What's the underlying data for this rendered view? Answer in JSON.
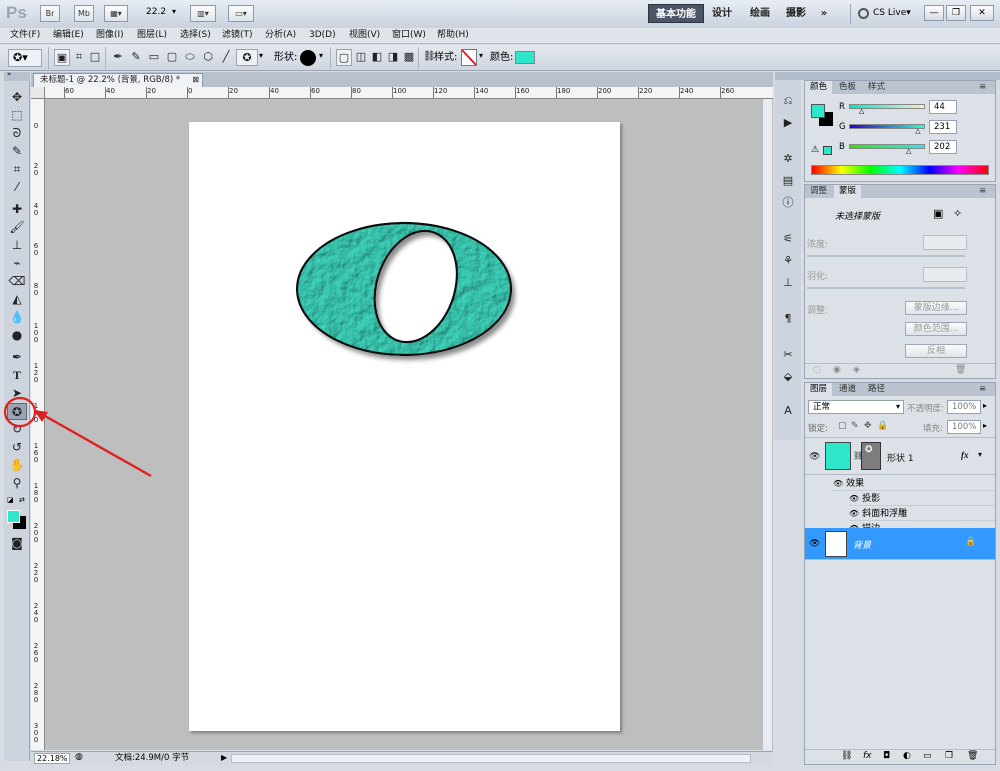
{
  "app": {
    "logo": "Ps",
    "bar_buttons": [
      "Br",
      "Mb"
    ],
    "zoom_value": "22.2",
    "workspaces": [
      "基本功能",
      "设计",
      "绘画",
      "摄影"
    ],
    "more_workspaces": "»",
    "cs_live": "CS Live▾",
    "window_controls": [
      "—",
      "❐",
      "✕"
    ]
  },
  "menu": [
    "文件(F)",
    "编辑(E)",
    "图像(I)",
    "图层(L)",
    "选择(S)",
    "滤镜(T)",
    "分析(A)",
    "3D(D)",
    "视图(V)",
    "窗口(W)",
    "帮助(H)"
  ],
  "options": {
    "shape_label": "形状:",
    "style_label": "样式:",
    "color_label": "颜色:",
    "fill_color": "#2ce7ca"
  },
  "document": {
    "tab_title": "未标题-1 @ 22.2% (背景, RGB/8) *",
    "ruler_top": [
      "60",
      "40",
      "20",
      "0",
      "20",
      "40",
      "60",
      "80",
      "100",
      "120",
      "140",
      "160",
      "180",
      "200",
      "220",
      "240",
      "260"
    ],
    "ruler_left": [
      "0",
      "20",
      "40",
      "60",
      "80",
      "100",
      "120",
      "140",
      "160",
      "180",
      "200",
      "220",
      "240",
      "260",
      "280",
      "300"
    ],
    "shape_fill": "#3fd6bd",
    "canvas_color": "#ffffff"
  },
  "status": {
    "zoom": "22.18%",
    "doc_info": "文档:24.9M/0 字节"
  },
  "color_panel": {
    "tabs": [
      "颜色",
      "色板",
      "样式"
    ],
    "channels": [
      {
        "label": "R",
        "value": "44",
        "fraction": 0.17
      },
      {
        "label": "G",
        "value": "231",
        "fraction": 0.91
      },
      {
        "label": "B",
        "value": "202",
        "fraction": 0.79
      }
    ],
    "foreground": "#2ce7ca",
    "background": "#000000"
  },
  "masks_panel": {
    "tabs": [
      "调整",
      "蒙版"
    ],
    "no_mask": "未选择蒙版",
    "density": "浓度:",
    "feather": "羽化:",
    "refine": "调整:",
    "mask_edge": "蒙版边缘...",
    "color_range": "颜色范围...",
    "invert": "反相"
  },
  "layers_panel": {
    "tabs": [
      "图层",
      "通道",
      "路径"
    ],
    "blend_mode": "正常",
    "opacity_label": "不透明度:",
    "opacity_value": "100%",
    "lock_label": "锁定:",
    "fill_label": "填充:",
    "fill_value": "100%",
    "layers": [
      {
        "name": "形状 1",
        "fx": "fx"
      },
      {
        "name": "背景"
      }
    ],
    "effects_label": "效果",
    "effects": [
      "投影",
      "斜面和浮雕",
      "描边"
    ],
    "selected_color": "#3399ff"
  },
  "annotation_color": "#e02020"
}
